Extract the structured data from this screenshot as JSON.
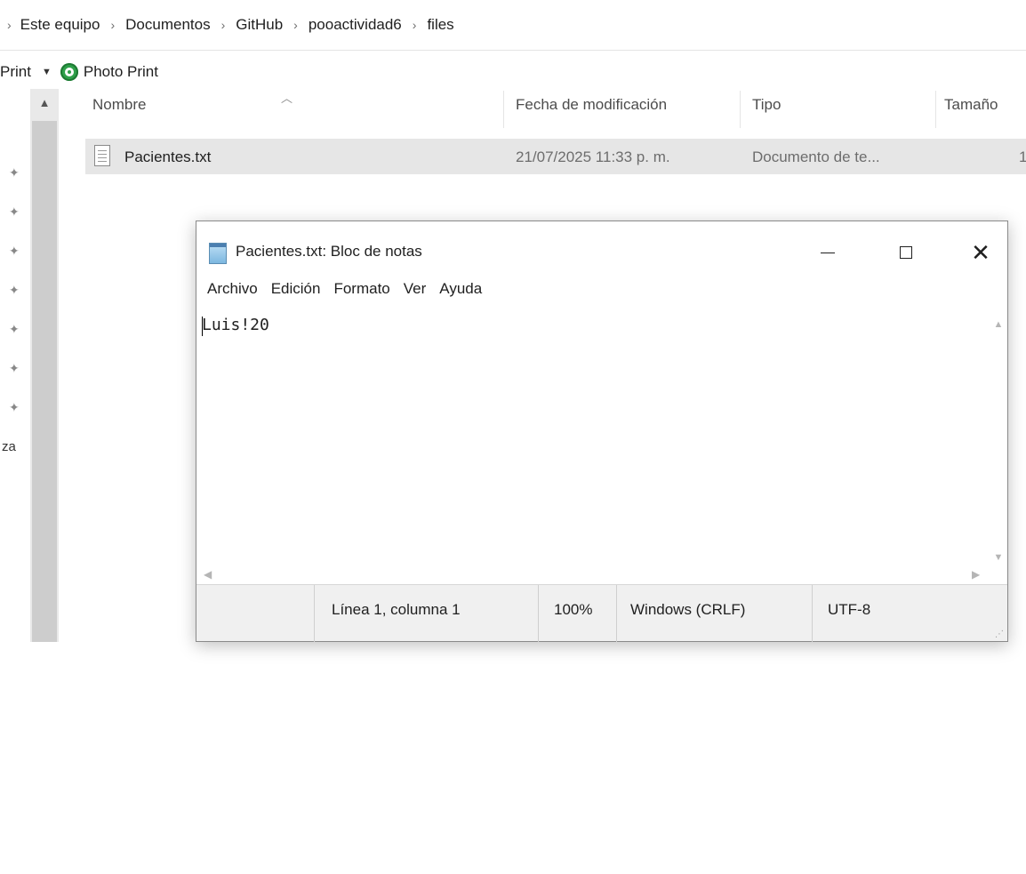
{
  "breadcrumb": {
    "items": [
      "Este equipo",
      "Documentos",
      "GitHub",
      "pooactividad6",
      "files"
    ]
  },
  "toolbar": {
    "print_label": "Print",
    "photo_print_label": "Photo Print"
  },
  "nav": {
    "partial_label": "za"
  },
  "columns": {
    "name": "Nombre",
    "date": "Fecha de modificación",
    "type": "Tipo",
    "size": "Tamaño"
  },
  "files": [
    {
      "name": "Pacientes.txt",
      "date": "21/07/2025 11:33 p. m.",
      "type": "Documento de te...",
      "size": "1"
    }
  ],
  "notepad": {
    "title": "Pacientes.txt: Bloc de notas",
    "menu": [
      "Archivo",
      "Edición",
      "Formato",
      "Ver",
      "Ayuda"
    ],
    "content": "Luis!20",
    "status": {
      "position": "Línea 1, columna 1",
      "zoom": "100%",
      "line_ending": "Windows (CRLF)",
      "encoding": "UTF-8"
    }
  },
  "colors": {
    "selected_row": "#e6e6e6",
    "statusbar": "#f0f0f0",
    "photo_print_icon": "#2fa04a"
  }
}
